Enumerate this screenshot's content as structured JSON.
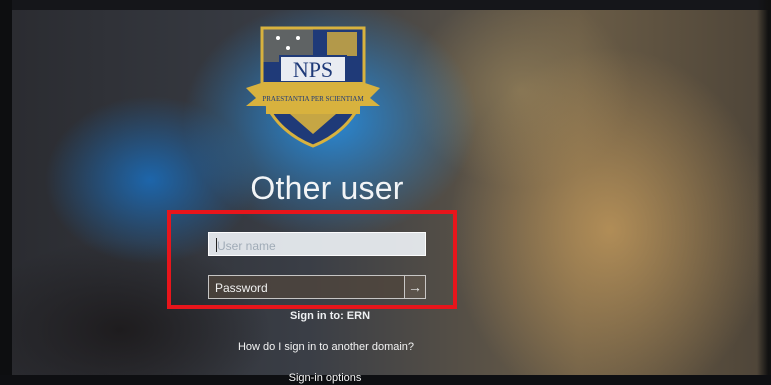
{
  "logo": {
    "acronym": "NPS",
    "motto": "PRAESTANTIA PER SCIENTIAM",
    "colors": {
      "navy": "#1f3a78",
      "gold": "#d8b23e"
    }
  },
  "login": {
    "title": "Other user",
    "username_placeholder": "User name",
    "password_placeholder": "Password",
    "submit_icon": "→",
    "sign_in_to": "Sign in to: ERN",
    "domain_link": "How do I sign in to another domain?",
    "options_link": "Sign-in options"
  },
  "annotation": {
    "color": "#e8151b"
  }
}
